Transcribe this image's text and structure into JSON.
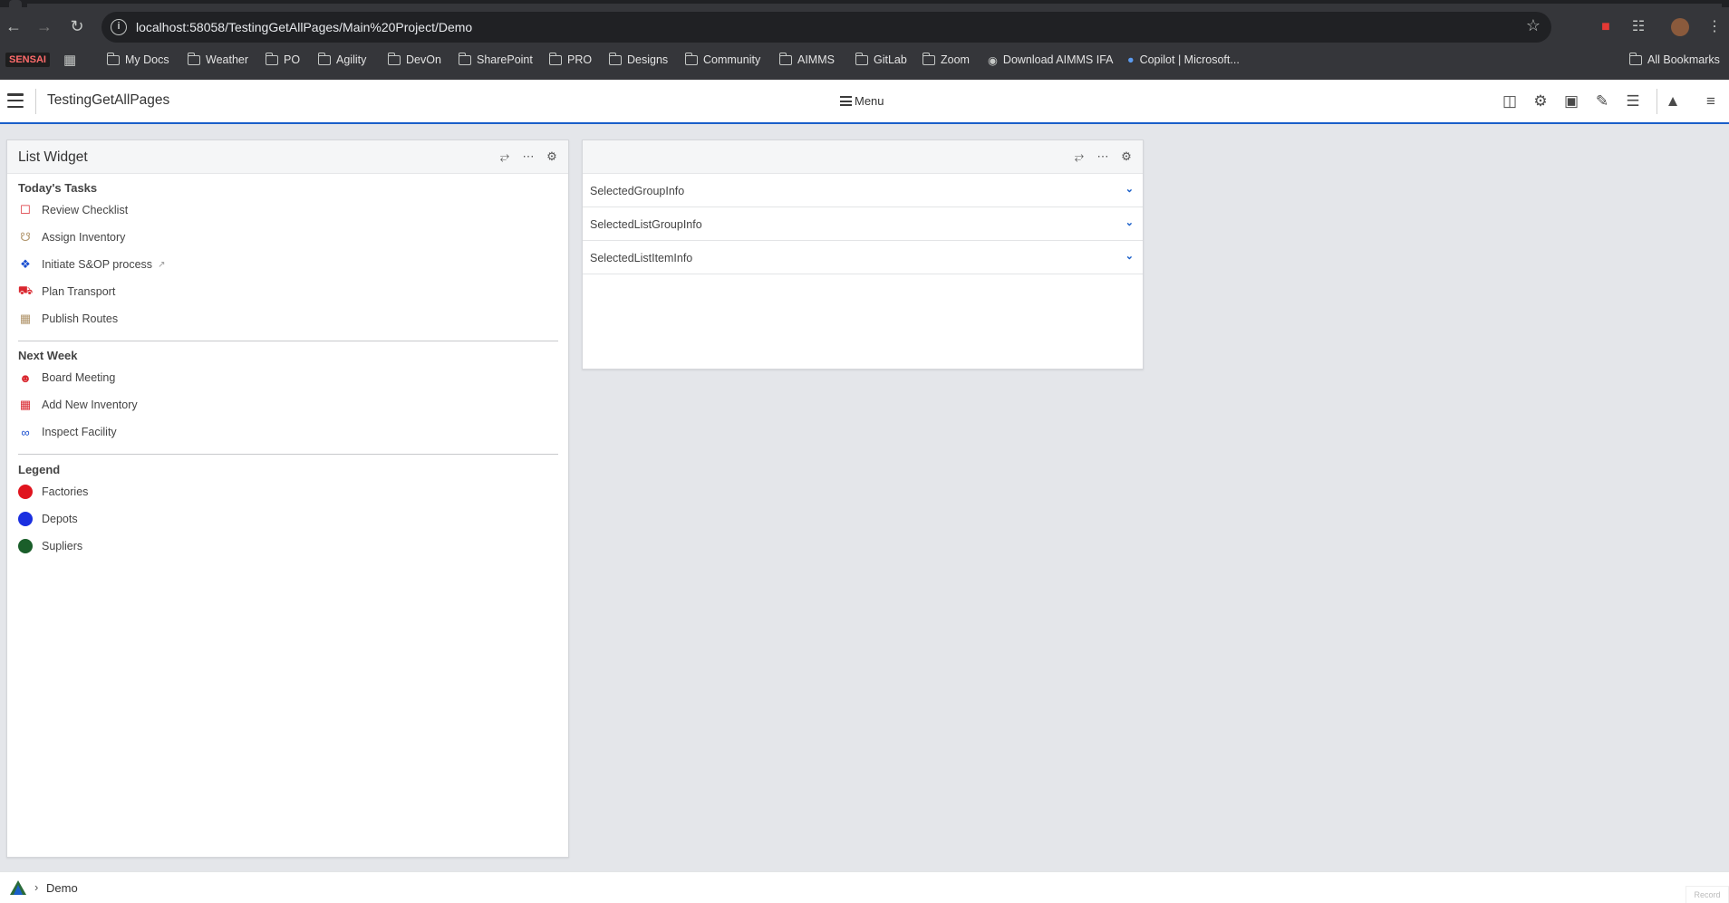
{
  "browser": {
    "url": "localhost:58058/TestingGetAllPages/Main%20Project/Demo",
    "bookmarks": [
      "My Docs",
      "Weather",
      "PO",
      "Agility",
      "DevOn",
      "SharePoint",
      "PRO",
      "Designs",
      "Community",
      "AIMMS",
      "GitLab",
      "Zoom",
      "Download AIMMS IFA",
      "Copilot | Microsoft..."
    ],
    "sensai": "SENSAI",
    "all_bookmarks": "All Bookmarks"
  },
  "app": {
    "title": "TestingGetAllPages",
    "menu_label": "Menu",
    "accent": "#1a5fc9"
  },
  "list_widget": {
    "title": "List Widget",
    "groups": [
      {
        "title": "Today's Tasks",
        "items": [
          {
            "label": "Review Checklist",
            "icon": "checklist-icon",
            "color": "#d9262e"
          },
          {
            "label": "Assign Inventory",
            "icon": "cart-icon",
            "color": "#b0946a"
          },
          {
            "label": "Initiate S&OP process",
            "icon": "process-icon",
            "color": "#1a4fd0"
          },
          {
            "label": "Plan Transport",
            "icon": "truck-icon",
            "color": "#d9262e"
          },
          {
            "label": "Publish Routes",
            "icon": "routes-icon",
            "color": "#b0946a"
          }
        ]
      },
      {
        "title": "Next Week",
        "items": [
          {
            "label": "Board Meeting",
            "icon": "people-icon",
            "color": "#d9262e"
          },
          {
            "label": "Add New Inventory",
            "icon": "add-file-icon",
            "color": "#d9262e"
          },
          {
            "label": "Inspect Facility",
            "icon": "link-icon",
            "color": "#1a4fd0"
          }
        ]
      },
      {
        "title": "Legend",
        "items": [
          {
            "label": "Factories",
            "icon": "red-dot",
            "color": "#e0141e"
          },
          {
            "label": "Depots",
            "icon": "blue-dot",
            "color": "#1a2fe0"
          },
          {
            "label": "Supliers",
            "icon": "green-dot",
            "color": "#1a5e2a"
          }
        ]
      }
    ]
  },
  "info_widget": {
    "rows": [
      "SelectedGroupInfo",
      "SelectedListGroupInfo",
      "SelectedListItemInfo"
    ]
  },
  "footer": {
    "crumb": "Demo",
    "record": "Record"
  }
}
